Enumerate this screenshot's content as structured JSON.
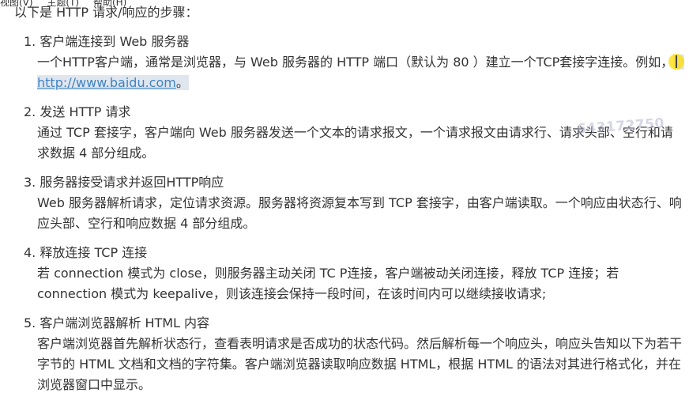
{
  "menu": [
    "视图(V)",
    "主题(T)",
    "帮助(H)"
  ],
  "intro": "以下是 HTTP 请求/响应的步骤：",
  "steps": [
    {
      "title": "1. 客户端连接到 Web 服务器",
      "body_before": "一个HTTP客户端，通常是浏览器，与 Web 服务器的 HTTP 端口（默认为 80 ）建立一个TCP套接字连接。例如，",
      "link": "http://www.baidu.com",
      "body_after": "。"
    },
    {
      "title": "2. 发送 HTTP 请求",
      "body": "通过 TCP 套接字，客户端向 Web 服务器发送一个文本的请求报文，一个请求报文由请求行、请求头部、空行和请求数据 4 部分组成。"
    },
    {
      "title": "3. 服务器接受请求并返回HTTP响应",
      "body": "Web 服务器解析请求，定位请求资源。服务器将资源复本写到 TCP 套接字，由客户端读取。一个响应由状态行、响应头部、空行和响应数据 4 部分组成。"
    },
    {
      "title": "4. 释放连接 TCP 连接",
      "body": "若 connection 模式为 close，则服务器主动关闭 TC P连接，客户端被动关闭连接，释放 TCP 连接；若 connection 模式为 keepalive，则该连接会保持一段时间，在该时间内可以继续接收请求;"
    },
    {
      "title": "5. 客户端浏览器解析 HTML 内容",
      "body": "客户端浏览器首先解析状态行，查看表明请求是否成功的状态代码。然后解析每一个响应头，响应头告知以下为若干字节的 HTML 文档和文档的字符集。客户端浏览器读取响应数据 HTML，根据 HTML 的语法对其进行格式化，并在浏览器窗口中显示。"
    }
  ],
  "watermark": "643172750"
}
